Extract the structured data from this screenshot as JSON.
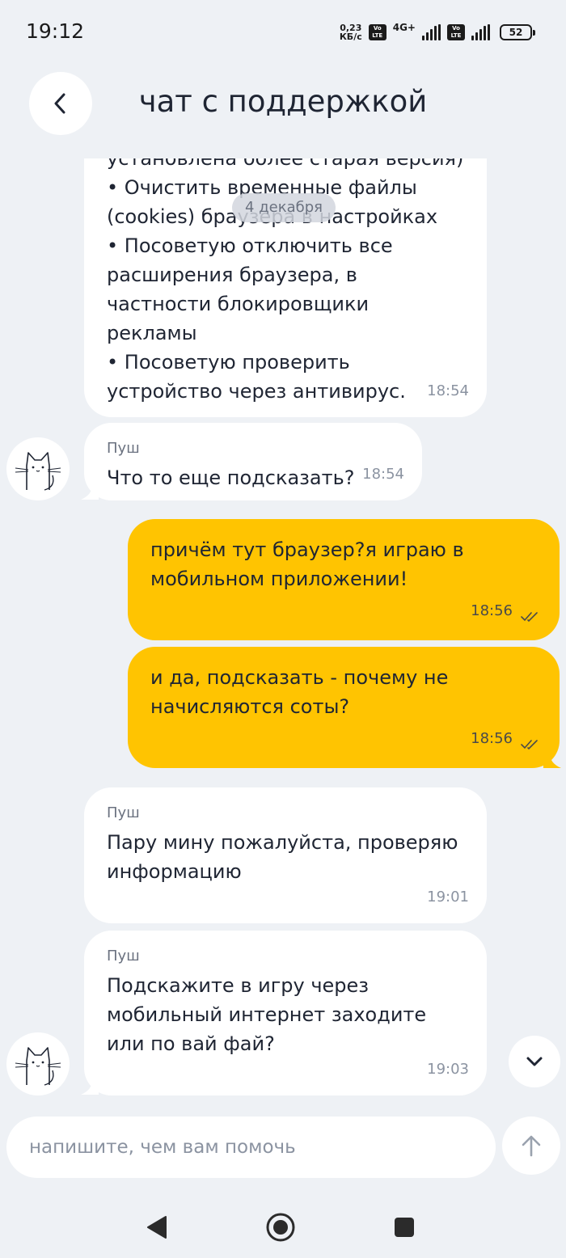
{
  "status_bar": {
    "time": "19:12",
    "net_speed_value": "0,23",
    "net_speed_unit": "КБ/с",
    "volte": "Vo LTE",
    "net_type": "4G+",
    "battery": "52"
  },
  "header": {
    "title": "чат с поддержкой",
    "back_icon": "chevron-left-icon"
  },
  "chat": {
    "date_chip": "4 декабря",
    "messages": [
      {
        "direction": "in",
        "sender": "",
        "text": "установлена более старая версия)\n•    Очистить временные файлы (cookies) браузера в настройках\n•    Посоветую отключить все расширения браузера, в частности блокировщики рекламы\n•    Посоветую проверить устройство через антивирус.",
        "time": "18:54"
      },
      {
        "direction": "in",
        "sender": "Пуш",
        "text": "Что то еще подсказать?",
        "time": "18:54"
      },
      {
        "direction": "out",
        "text": "причём тут браузер?я играю в мобильном приложении!",
        "time": "18:56",
        "status_icon": "double-check-icon"
      },
      {
        "direction": "out",
        "text": "и да, подсказать - почему не начисляются соты?",
        "time": "18:56",
        "status_icon": "double-check-icon"
      },
      {
        "direction": "in",
        "sender": "Пуш",
        "text": "Пару мину пожалуйста, проверяю информацию",
        "time": "19:01"
      },
      {
        "direction": "in",
        "sender": "Пуш",
        "text": "Подскажите в игру через мобильный интернет заходите или по вай фай?",
        "time": "19:03"
      }
    ],
    "avatar_icon": "cat-avatar-icon",
    "scroll_down_icon": "chevron-down-icon"
  },
  "composer": {
    "placeholder": "напишите, чем вам помочь",
    "value": "",
    "send_icon": "arrow-up-icon"
  },
  "nav_bar": {
    "back": "triangle-back-icon",
    "home": "circle-home-icon",
    "recents": "square-recents-icon"
  },
  "colors": {
    "background": "#eef1f5",
    "incoming_bubble": "#ffffff",
    "outgoing_bubble": "#ffc401",
    "text": "#1f2533",
    "muted": "#8b93a1"
  }
}
